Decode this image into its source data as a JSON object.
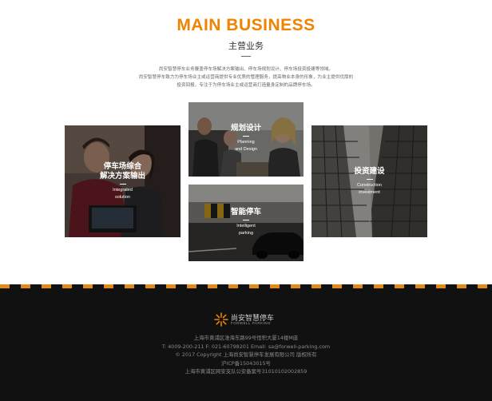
{
  "section": {
    "title": "MAIN BUSINESS",
    "subtitle": "主营业务",
    "intro": [
      "尚安智慧停车业务覆盖停车场解决方案输出、停车场规划设计、停车场投资投建等领域。",
      "尚安智慧停车致力为停车场业主或运营商提供专业优质的管理服务，提高物业本身的形象，为业主提供优厚的",
      "投资回报，专注于为停车场业主或运营商打造量身定制的品牌停车场。"
    ]
  },
  "cards": [
    {
      "cn_line1": "停车场综合",
      "cn_line2": "解决方案输出",
      "en_line1": "Integrated",
      "en_line2": "solution"
    },
    {
      "cn_line1": "规划设计",
      "en_line1": "Planning",
      "en_line2": "and Design"
    },
    {
      "cn_line1": "智能停车",
      "en_line1": "Intelligent",
      "en_line2": "parking"
    },
    {
      "cn_line1": "投资建设",
      "en_line1": "Construction",
      "en_line2": "investment"
    }
  ],
  "footer": {
    "logo_text": "尚安智慧停车",
    "logo_sub": "FORWELL PARKING",
    "address": "上海市黄浦区淮海东路99号恒积大厦14楼M座",
    "contact": "T: 4009-200-211    F: 021-60798201    Email: sa@forwell-parking.com",
    "copyright": "© 2017 Copyright 上海尚安智慧停车发展有限公司 版权所有",
    "icp": "沪ICP备15043015号",
    "police": "上海市黄浦区网安支队公安备案号31010102002859"
  },
  "colors": {
    "accent": "#f08300",
    "footer_bg": "#111111",
    "stripe": "#e08a1e"
  }
}
